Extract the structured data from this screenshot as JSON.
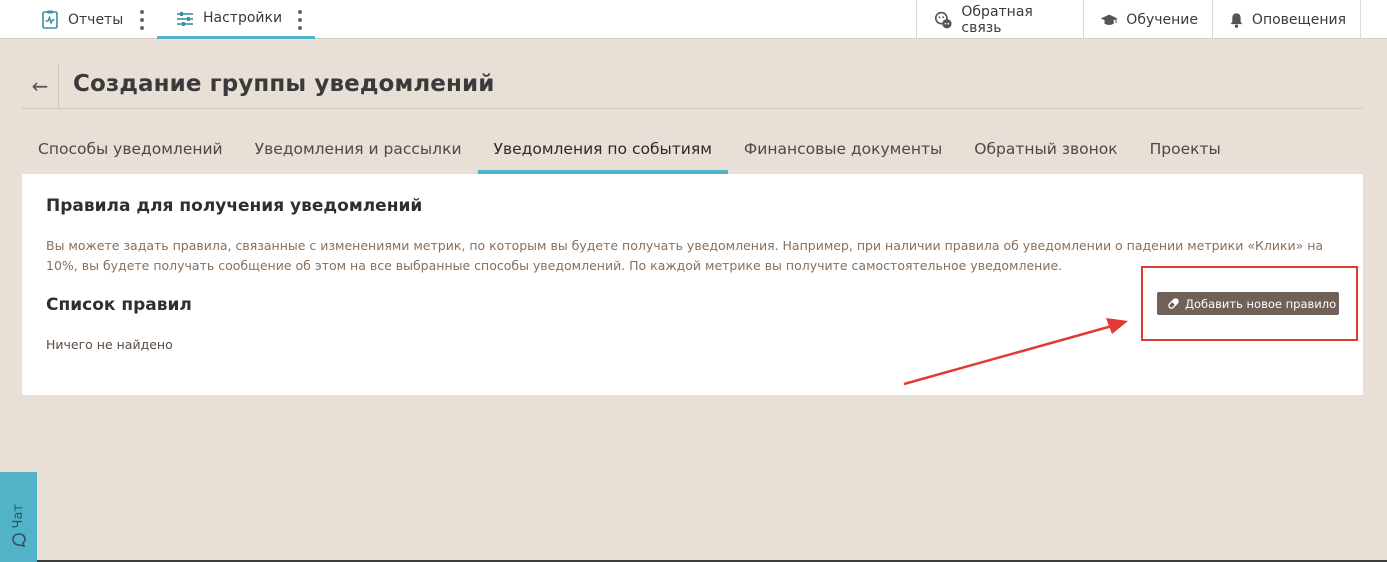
{
  "topbar": {
    "left": [
      {
        "label": "Отчеты",
        "icon": "clipboard-chart-icon"
      },
      {
        "label": "Настройки",
        "icon": "sliders-icon",
        "active": true
      }
    ],
    "right": [
      {
        "label": "Обратная связь",
        "icon": "feedback-icon"
      },
      {
        "label": "Обучение",
        "icon": "graduation-cap-icon"
      },
      {
        "label": "Оповещения",
        "icon": "bell-icon"
      }
    ]
  },
  "header": {
    "back": "←",
    "title": "Создание группы уведомлений"
  },
  "tabs": [
    {
      "label": "Способы уведомлений"
    },
    {
      "label": "Уведомления и рассылки"
    },
    {
      "label": "Уведомления по событиям",
      "active": true
    },
    {
      "label": "Финансовые документы"
    },
    {
      "label": "Обратный звонок"
    },
    {
      "label": "Проекты"
    }
  ],
  "card": {
    "rules_title": "Правила для получения уведомлений",
    "description": "Вы можете задать правила, связанные с изменениями метрик, по которым вы будете получать уведомления. Например, при наличии правила об уведомлении о падении метрики «Клики» на 10%, вы будете получать сообщение об этом на все выбранные способы уведомлений. По каждой метрике вы получите самостоятельное уведомление.",
    "list_title": "Список правил",
    "empty_text": "Ничего не найдено",
    "add_button": "Добавить новое правило"
  },
  "chat": {
    "label": "Чат"
  },
  "colors": {
    "accent": "#52b2c7",
    "background": "#e8dfd6",
    "button": "#6f6157",
    "annotation": "#e03a32"
  }
}
